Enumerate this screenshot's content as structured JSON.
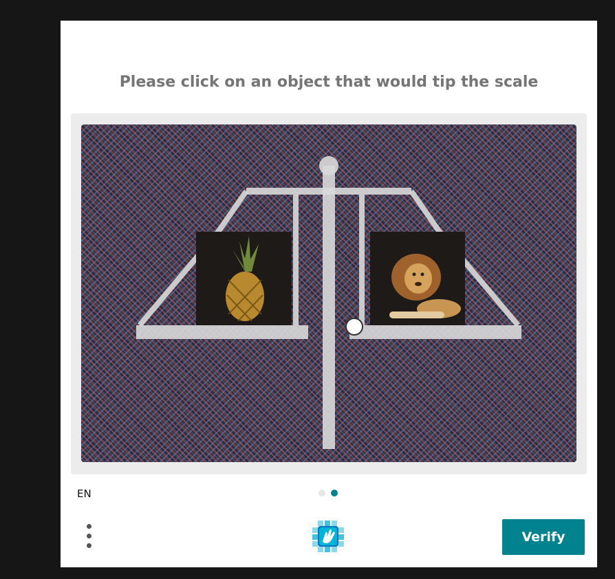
{
  "challenge": {
    "prompt": "Please click on an object that would tip the scale"
  },
  "image": {
    "left_object": "pineapple",
    "right_object": "lion",
    "center_marker": "circle-marker"
  },
  "footer": {
    "language": "EN",
    "page_indicator": {
      "total": 2,
      "active": 2
    },
    "menu_icon": "vertical-dots-icon",
    "logo_icon": "hcaptcha-hand-icon",
    "verify_label": "Verify"
  },
  "colors": {
    "accent": "#00838f",
    "prompt_text": "#757575",
    "frame": "#ececec",
    "background": "#161616"
  }
}
